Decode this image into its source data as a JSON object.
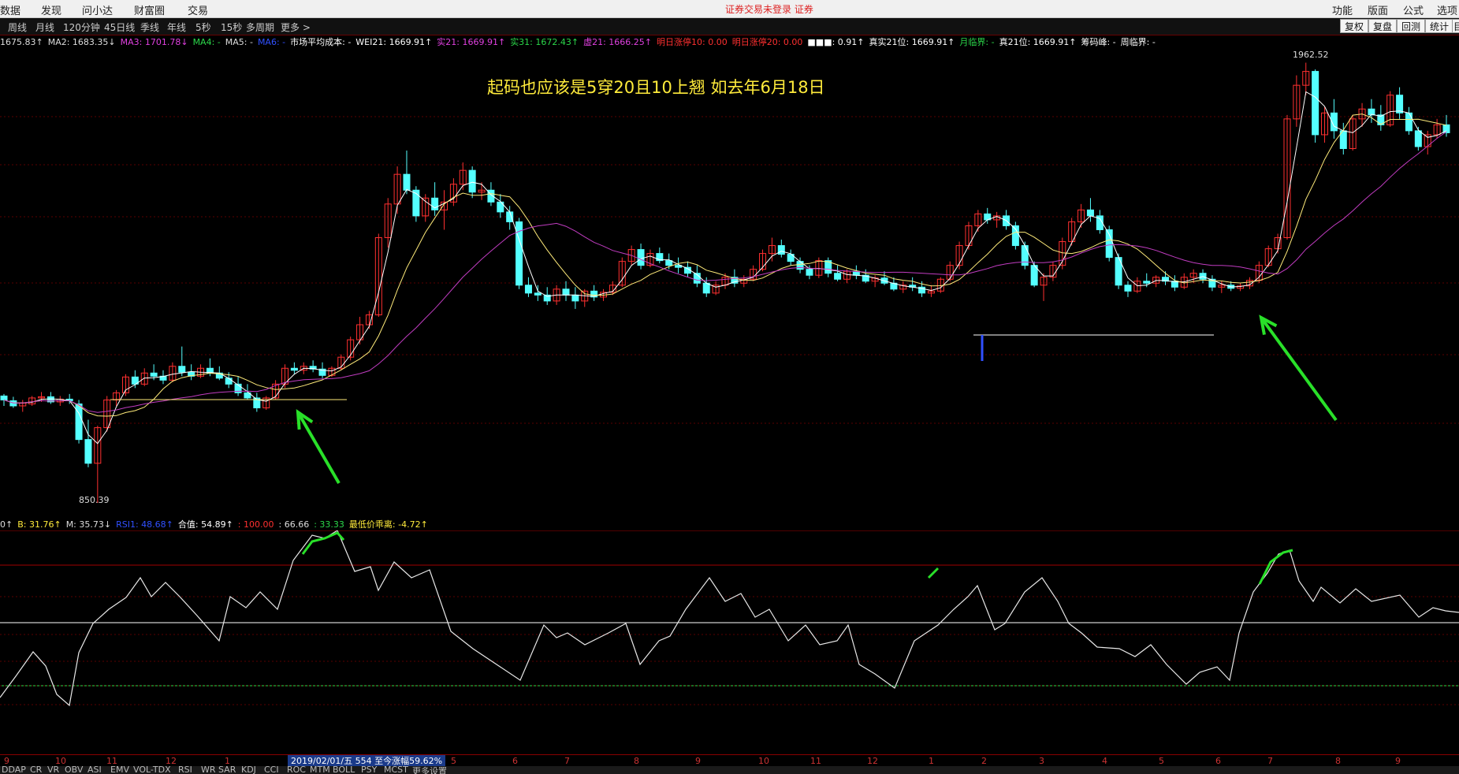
{
  "menu": {
    "left": [
      "数据",
      "发现",
      "问小达",
      "财富圈",
      "交易"
    ],
    "center": "证券交易未登录  证券",
    "right": [
      "功能",
      "版面",
      "公式",
      "选项"
    ]
  },
  "periods": [
    "周线",
    "月线",
    "120分钟",
    "45日线",
    "季线",
    "年线",
    "5秒",
    "15秒",
    "多周期",
    "更多 >"
  ],
  "right_buttons": [
    "复权",
    "复盘",
    "回测",
    "统计",
    "目"
  ],
  "ma_legend": [
    {
      "text": "1675.83↑",
      "color": "#dddddd"
    },
    {
      "text": "MA2: 1683.35↓",
      "color": "#dddddd"
    },
    {
      "text": "MA3: 1701.78↓",
      "color": "#e040e0"
    },
    {
      "text": "MA4: -",
      "color": "#2bd84a"
    },
    {
      "text": "MA5: -",
      "color": "#dddddd"
    },
    {
      "text": "MA6: -",
      "color": "#3050ff"
    },
    {
      "text": "市场平均成本: -",
      "color": "#ffffff"
    },
    {
      "text": "WEI21: 1669.91↑",
      "color": "#ffffff"
    },
    {
      "text": "实21: 1669.91↑",
      "color": "#e040e0"
    },
    {
      "text": "实31: 1672.43↑",
      "color": "#2bd84a"
    },
    {
      "text": "虚21: 1666.25↑",
      "color": "#e040e0"
    },
    {
      "text": "明日涨停10: 0.00",
      "color": "#ff3030"
    },
    {
      "text": "明日涨停20: 0.00",
      "color": "#ff3030"
    },
    {
      "text": "■■■: 0.91↑",
      "color": "#ffffff"
    },
    {
      "text": "真实21位: 1669.91↑",
      "color": "#ffffff"
    },
    {
      "text": "月临界: -",
      "color": "#2bd84a"
    },
    {
      "text": "真21位: 1669.91↑",
      "color": "#ffffff"
    },
    {
      "text": "筹码峰: -",
      "color": "#ffffff"
    },
    {
      "text": "周临界: -",
      "color": "#ffffff"
    }
  ],
  "annotation": "起码也应该是5穿20且10上翘 如去年6月18日",
  "price_labels": {
    "high": "1962.52",
    "low": "850.39"
  },
  "indicator_legend": [
    {
      "text": "0↑",
      "color": "#dddddd"
    },
    {
      "text": "B: 31.76↑",
      "color": "#ffeb3b"
    },
    {
      "text": "M: 35.73↓",
      "color": "#dddddd"
    },
    {
      "text": "RSI1: 48.68↑",
      "color": "#3050ff"
    },
    {
      "text": "合值: 54.89↑",
      "color": "#ffffff"
    },
    {
      "text": ": 100.00",
      "color": "#ff3030"
    },
    {
      "text": ": 66.66",
      "color": "#dddddd"
    },
    {
      "text": ": 33.33",
      "color": "#2bd84a"
    },
    {
      "text": "最低价乖离: -4.72↑",
      "color": "#ffeb3b"
    }
  ],
  "date_ticks": [
    "9",
    "10",
    "11",
    "12",
    "1",
    "",
    "",
    "",
    "",
    "5",
    "6",
    "7",
    "8",
    "9",
    "10",
    "11",
    "12",
    "1",
    "2",
    "3",
    "4",
    "5",
    "6",
    "7",
    "8",
    "9"
  ],
  "date_hint": "2019/02/01/五 554 至今涨幅59.62%",
  "bottom_tabs": [
    "DDAP",
    "CR",
    "VR",
    "OBV",
    "ASI",
    "EMV",
    "VOL-TDX",
    "RSI",
    "WR",
    "SAR",
    "KDJ",
    "CCI",
    "ROC",
    "MTM",
    "BOLL",
    "PSY",
    "MCST",
    "更多",
    "设置"
  ],
  "colors": {
    "up": "#ff3030",
    "down": "#54ffff",
    "ma1": "#ffffff",
    "ma2": "#ffeb7a",
    "ma3": "#c03cc0",
    "arrow": "#29e029"
  },
  "chart_data": {
    "type": "candlestick",
    "ylim": [
      850,
      1975
    ],
    "candles": [
      [
        1120,
        1125,
        1095,
        1110
      ],
      [
        1108,
        1118,
        1090,
        1095
      ],
      [
        1095,
        1110,
        1080,
        1102
      ],
      [
        1100,
        1120,
        1095,
        1115
      ],
      [
        1115,
        1130,
        1105,
        1118
      ],
      [
        1118,
        1130,
        1100,
        1105
      ],
      [
        1105,
        1120,
        1095,
        1112
      ],
      [
        1112,
        1125,
        1100,
        1108
      ],
      [
        1100,
        1110,
        1000,
        1010
      ],
      [
        1010,
        1060,
        940,
        950
      ],
      [
        950,
        1045,
        850,
        1040
      ],
      [
        1040,
        1120,
        1030,
        1110
      ],
      [
        1110,
        1135,
        1095,
        1128
      ],
      [
        1128,
        1175,
        1120,
        1168
      ],
      [
        1168,
        1185,
        1140,
        1150
      ],
      [
        1150,
        1190,
        1145,
        1178
      ],
      [
        1178,
        1200,
        1160,
        1170
      ],
      [
        1170,
        1185,
        1150,
        1160
      ],
      [
        1160,
        1205,
        1155,
        1195
      ],
      [
        1195,
        1245,
        1170,
        1180
      ],
      [
        1180,
        1200,
        1160,
        1170
      ],
      [
        1170,
        1200,
        1165,
        1190
      ],
      [
        1190,
        1215,
        1170,
        1178
      ],
      [
        1178,
        1195,
        1160,
        1165
      ],
      [
        1165,
        1180,
        1140,
        1150
      ],
      [
        1150,
        1170,
        1120,
        1128
      ],
      [
        1128,
        1150,
        1110,
        1115
      ],
      [
        1115,
        1128,
        1080,
        1090
      ],
      [
        1090,
        1120,
        1085,
        1115
      ],
      [
        1115,
        1160,
        1110,
        1150
      ],
      [
        1150,
        1200,
        1140,
        1190
      ],
      [
        1190,
        1205,
        1175,
        1185
      ],
      [
        1185,
        1205,
        1175,
        1195
      ],
      [
        1195,
        1210,
        1180,
        1188
      ],
      [
        1188,
        1205,
        1165,
        1172
      ],
      [
        1172,
        1195,
        1168,
        1190
      ],
      [
        1190,
        1225,
        1185,
        1218
      ],
      [
        1218,
        1270,
        1210,
        1262
      ],
      [
        1262,
        1320,
        1250,
        1300
      ],
      [
        1300,
        1335,
        1290,
        1325
      ],
      [
        1325,
        1530,
        1320,
        1520
      ],
      [
        1520,
        1620,
        1495,
        1605
      ],
      [
        1605,
        1700,
        1580,
        1680
      ],
      [
        1680,
        1740,
        1630,
        1640
      ],
      [
        1640,
        1650,
        1560,
        1575
      ],
      [
        1575,
        1630,
        1560,
        1620
      ],
      [
        1620,
        1660,
        1575,
        1590
      ],
      [
        1590,
        1640,
        1540,
        1610
      ],
      [
        1610,
        1670,
        1600,
        1655
      ],
      [
        1655,
        1710,
        1640,
        1690
      ],
      [
        1690,
        1700,
        1620,
        1635
      ],
      [
        1635,
        1660,
        1615,
        1640
      ],
      [
        1640,
        1660,
        1600,
        1610
      ],
      [
        1610,
        1630,
        1570,
        1585
      ],
      [
        1585,
        1600,
        1540,
        1560
      ],
      [
        1560,
        1570,
        1390,
        1400
      ],
      [
        1400,
        1420,
        1370,
        1380
      ],
      [
        1380,
        1400,
        1360,
        1375
      ],
      [
        1375,
        1395,
        1350,
        1360
      ],
      [
        1360,
        1400,
        1350,
        1390
      ],
      [
        1390,
        1410,
        1360,
        1375
      ],
      [
        1375,
        1395,
        1340,
        1360
      ],
      [
        1360,
        1390,
        1345,
        1385
      ],
      [
        1385,
        1400,
        1360,
        1370
      ],
      [
        1370,
        1390,
        1360,
        1382
      ],
      [
        1382,
        1410,
        1375,
        1400
      ],
      [
        1400,
        1470,
        1395,
        1460
      ],
      [
        1460,
        1500,
        1450,
        1490
      ],
      [
        1490,
        1505,
        1440,
        1450
      ],
      [
        1450,
        1490,
        1445,
        1480
      ],
      [
        1480,
        1495,
        1455,
        1462
      ],
      [
        1462,
        1480,
        1440,
        1450
      ],
      [
        1450,
        1470,
        1430,
        1445
      ],
      [
        1445,
        1460,
        1420,
        1430
      ],
      [
        1430,
        1450,
        1395,
        1405
      ],
      [
        1405,
        1420,
        1370,
        1380
      ],
      [
        1380,
        1410,
        1375,
        1400
      ],
      [
        1400,
        1430,
        1390,
        1420
      ],
      [
        1420,
        1440,
        1395,
        1405
      ],
      [
        1405,
        1425,
        1395,
        1415
      ],
      [
        1415,
        1450,
        1410,
        1440
      ],
      [
        1440,
        1490,
        1435,
        1480
      ],
      [
        1480,
        1520,
        1460,
        1500
      ],
      [
        1500,
        1515,
        1470,
        1478
      ],
      [
        1478,
        1490,
        1450,
        1460
      ],
      [
        1460,
        1470,
        1430,
        1440
      ],
      [
        1440,
        1450,
        1415,
        1425
      ],
      [
        1425,
        1470,
        1418,
        1462
      ],
      [
        1462,
        1470,
        1420,
        1430
      ],
      [
        1430,
        1450,
        1410,
        1415
      ],
      [
        1415,
        1440,
        1405,
        1435
      ],
      [
        1435,
        1450,
        1415,
        1425
      ],
      [
        1425,
        1440,
        1405,
        1410
      ],
      [
        1410,
        1425,
        1395,
        1418
      ],
      [
        1418,
        1435,
        1400,
        1405
      ],
      [
        1405,
        1420,
        1385,
        1390
      ],
      [
        1390,
        1410,
        1380,
        1400
      ],
      [
        1400,
        1420,
        1385,
        1395
      ],
      [
        1395,
        1410,
        1370,
        1380
      ],
      [
        1380,
        1400,
        1370,
        1385
      ],
      [
        1385,
        1420,
        1380,
        1415
      ],
      [
        1415,
        1460,
        1410,
        1450
      ],
      [
        1450,
        1510,
        1440,
        1500
      ],
      [
        1500,
        1560,
        1490,
        1550
      ],
      [
        1550,
        1590,
        1535,
        1580
      ],
      [
        1580,
        1595,
        1555,
        1565
      ],
      [
        1565,
        1585,
        1545,
        1575
      ],
      [
        1575,
        1590,
        1540,
        1550
      ],
      [
        1550,
        1560,
        1490,
        1500
      ],
      [
        1500,
        1510,
        1440,
        1450
      ],
      [
        1450,
        1460,
        1395,
        1400
      ],
      [
        1400,
        1430,
        1360,
        1420
      ],
      [
        1420,
        1460,
        1410,
        1450
      ],
      [
        1450,
        1520,
        1440,
        1510
      ],
      [
        1510,
        1570,
        1500,
        1560
      ],
      [
        1560,
        1605,
        1545,
        1590
      ],
      [
        1590,
        1620,
        1560,
        1575
      ],
      [
        1575,
        1590,
        1530,
        1540
      ],
      [
        1540,
        1550,
        1460,
        1470
      ],
      [
        1470,
        1480,
        1390,
        1400
      ],
      [
        1400,
        1410,
        1370,
        1385
      ],
      [
        1385,
        1420,
        1380,
        1410
      ],
      [
        1410,
        1430,
        1395,
        1405
      ],
      [
        1405,
        1425,
        1395,
        1420
      ],
      [
        1420,
        1435,
        1400,
        1410
      ],
      [
        1410,
        1425,
        1385,
        1395
      ],
      [
        1395,
        1430,
        1390,
        1420
      ],
      [
        1420,
        1440,
        1405,
        1430
      ],
      [
        1430,
        1440,
        1405,
        1415
      ],
      [
        1415,
        1425,
        1385,
        1395
      ],
      [
        1395,
        1410,
        1380,
        1400
      ],
      [
        1400,
        1410,
        1385,
        1392
      ],
      [
        1392,
        1405,
        1385,
        1398
      ],
      [
        1398,
        1420,
        1390,
        1412
      ],
      [
        1412,
        1460,
        1405,
        1450
      ],
      [
        1450,
        1500,
        1445,
        1492
      ],
      [
        1492,
        1530,
        1480,
        1520
      ],
      [
        1520,
        1830,
        1515,
        1820
      ],
      [
        1820,
        1930,
        1800,
        1905
      ],
      [
        1905,
        1962,
        1880,
        1940
      ],
      [
        1940,
        1945,
        1760,
        1780
      ],
      [
        1780,
        1850,
        1760,
        1835
      ],
      [
        1835,
        1870,
        1770,
        1790
      ],
      [
        1790,
        1810,
        1730,
        1745
      ],
      [
        1745,
        1830,
        1740,
        1820
      ],
      [
        1820,
        1860,
        1800,
        1845
      ],
      [
        1845,
        1870,
        1810,
        1830
      ],
      [
        1830,
        1855,
        1790,
        1805
      ],
      [
        1805,
        1890,
        1800,
        1880
      ],
      [
        1880,
        1900,
        1820,
        1835
      ],
      [
        1835,
        1850,
        1780,
        1790
      ],
      [
        1790,
        1800,
        1740,
        1750
      ],
      [
        1750,
        1790,
        1730,
        1780
      ],
      [
        1780,
        1820,
        1770,
        1805
      ],
      [
        1805,
        1830,
        1775,
        1785
      ]
    ]
  }
}
